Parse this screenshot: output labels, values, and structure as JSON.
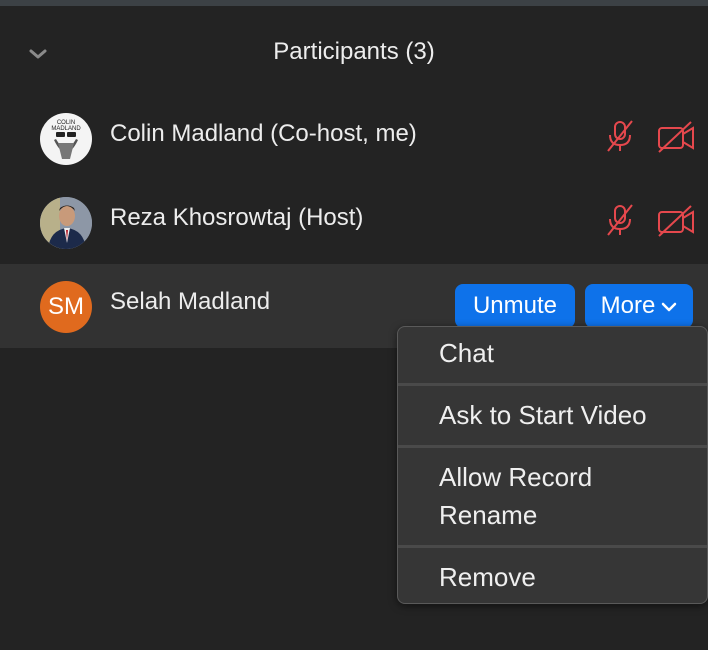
{
  "header": {
    "title": "Participants (3)"
  },
  "participants": [
    {
      "name": "Colin Madland (Co-host, me)",
      "avatar_type": "image",
      "mic": "muted",
      "video": "off"
    },
    {
      "name": "Reza Khosrowtaj (Host)",
      "avatar_type": "image",
      "mic": "muted",
      "video": "off"
    },
    {
      "name": "Selah Madland",
      "avatar_type": "initials",
      "initials": "SM",
      "avatar_color": "#e06a1e"
    }
  ],
  "actions": {
    "unmute_label": "Unmute",
    "more_label": "More"
  },
  "menu": {
    "items": [
      "Chat",
      "Ask to Start Video",
      "Allow Record",
      "Rename",
      "Remove"
    ]
  },
  "colors": {
    "accent": "#0e72ea",
    "muted_red": "#e5484d",
    "background": "#232323"
  }
}
